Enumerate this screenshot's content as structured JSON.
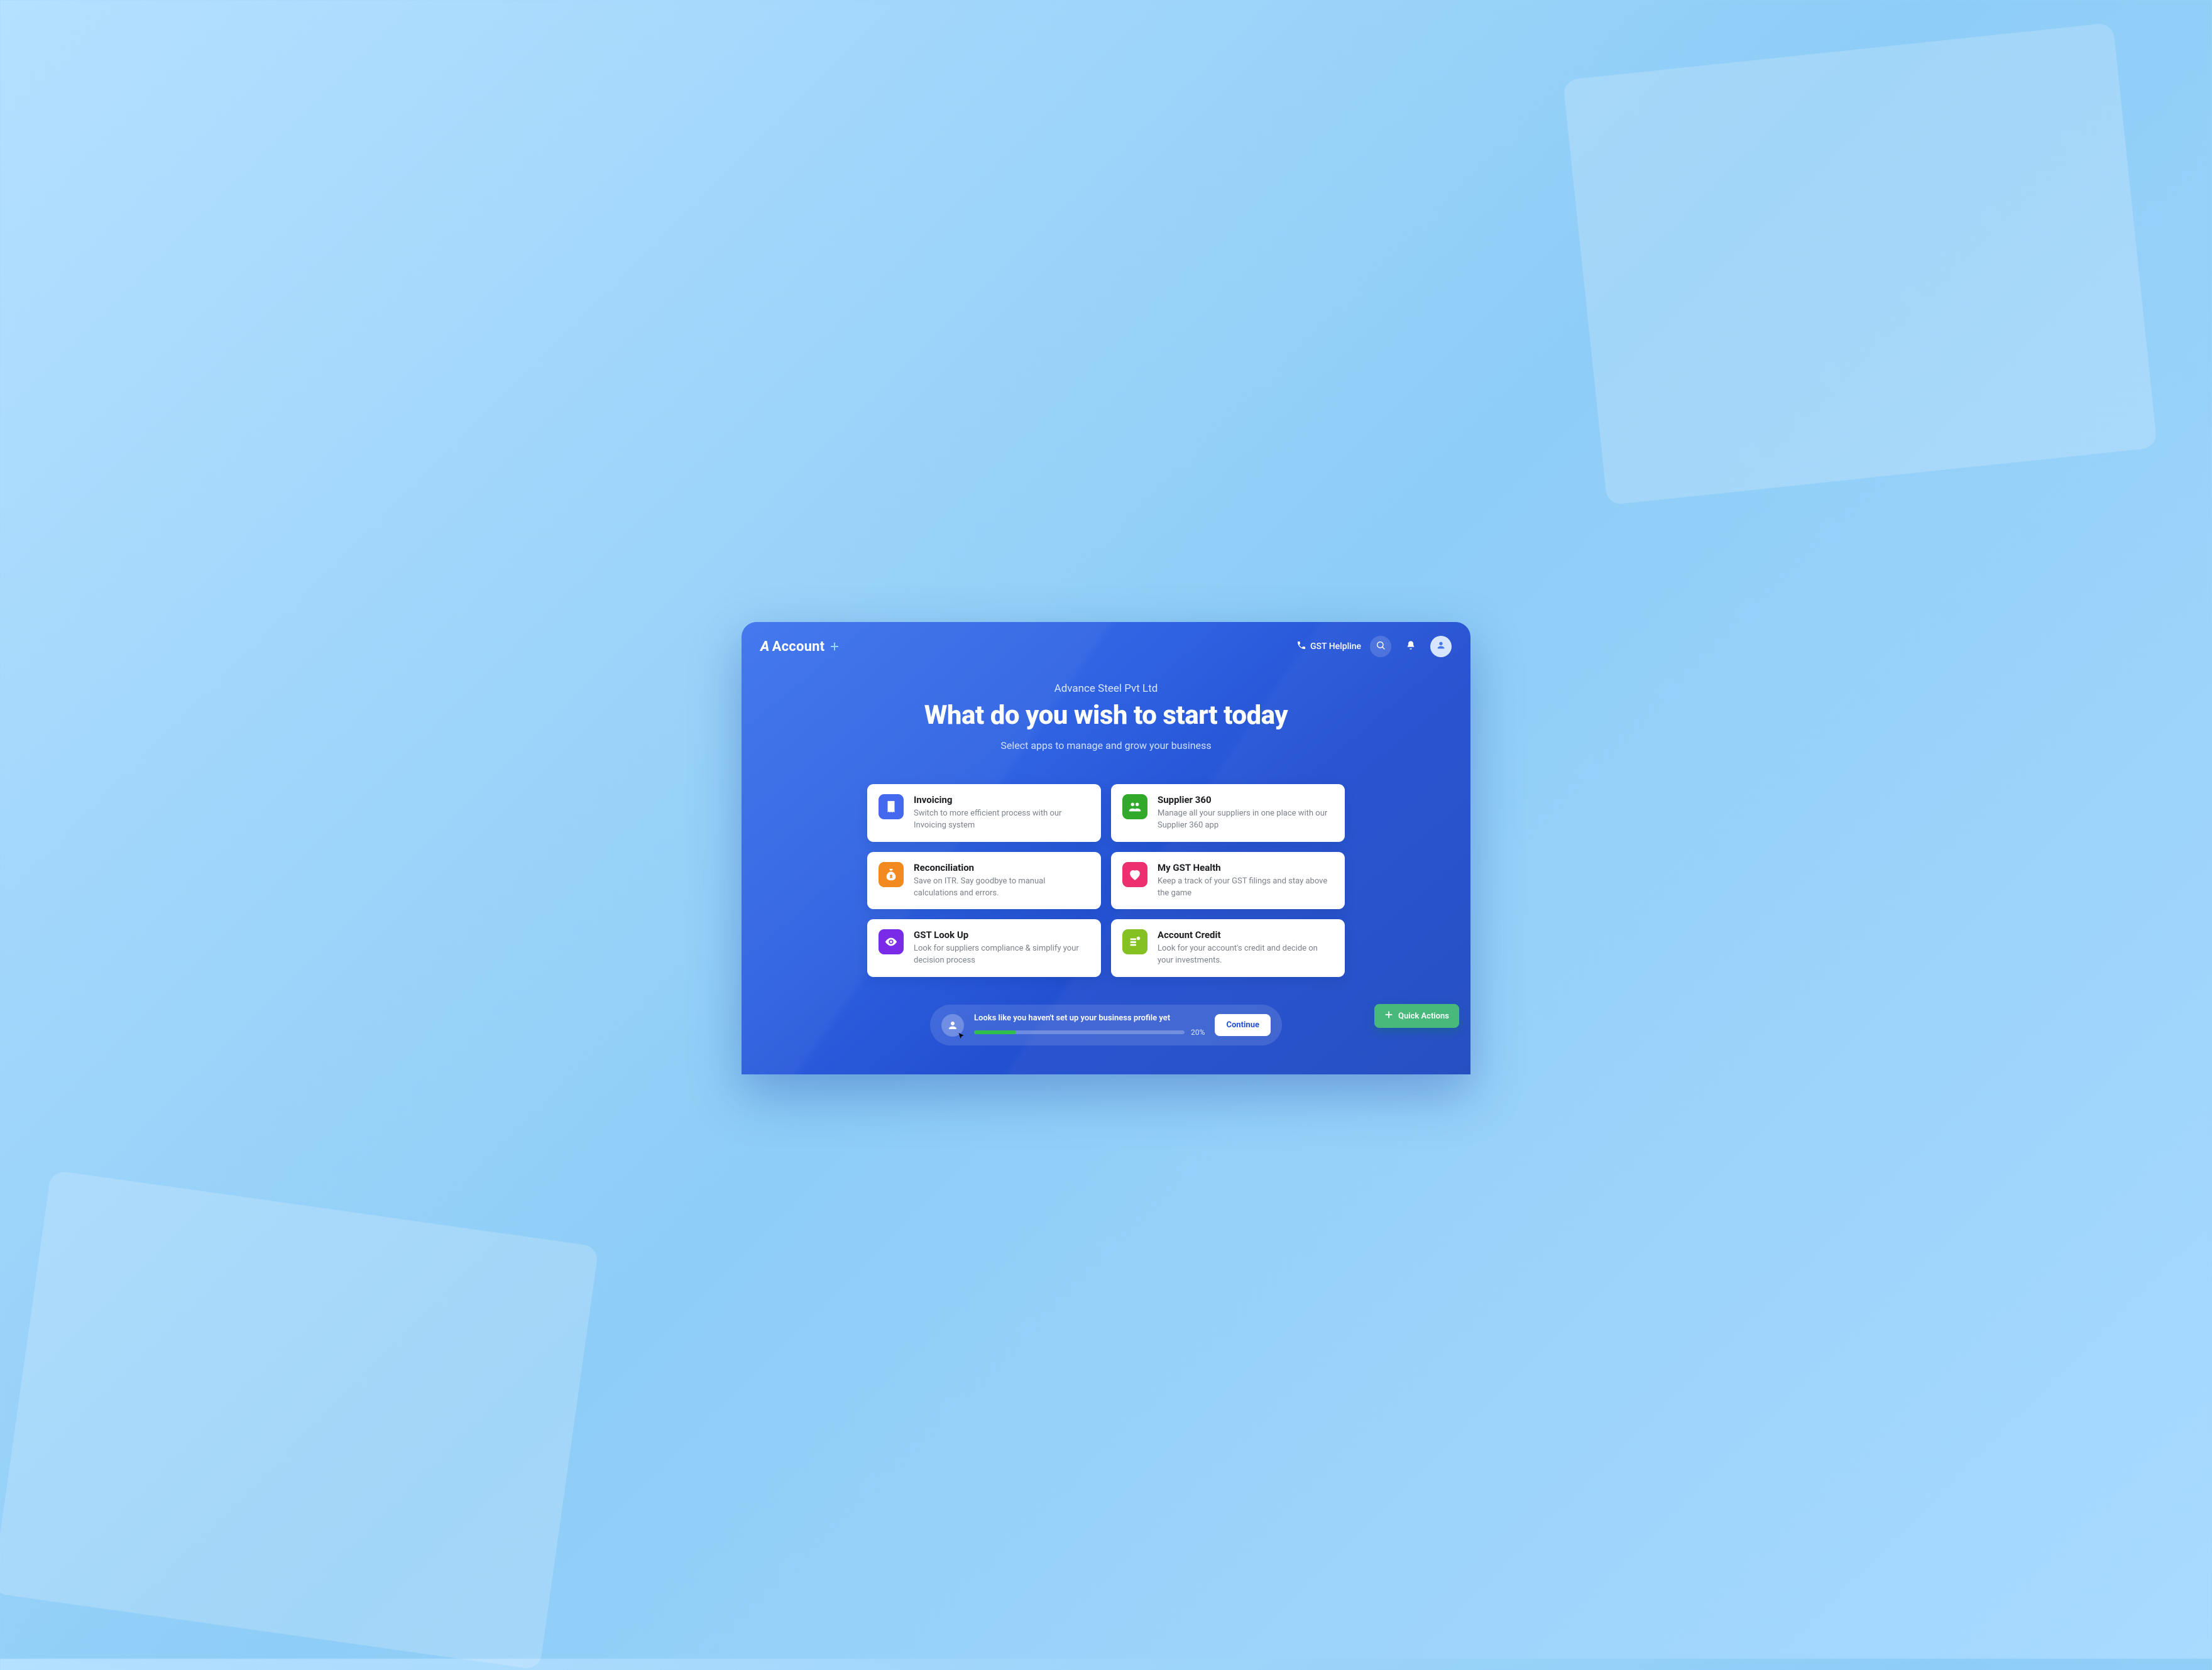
{
  "brand": {
    "name": "Account"
  },
  "header": {
    "helpline_label": "GST Helpline"
  },
  "hero": {
    "company": "Advance Steel Pvt Ltd",
    "title": "What do you wish to start today",
    "subtitle": "Select apps to manage and grow your business"
  },
  "apps": [
    {
      "key": "invoicing",
      "title": "Invoicing",
      "desc": "Switch to more efficient process with our Invoicing system",
      "color": "blue",
      "icon": "receipt"
    },
    {
      "key": "supplier360",
      "title": "Supplier 360",
      "desc": "Manage all your suppliers in one place with our Supplier 360 app",
      "color": "green",
      "icon": "people"
    },
    {
      "key": "reconciliation",
      "title": " Reconciliation",
      "desc": "Save on ITR. Say goodbye to manual calculations and errors.",
      "color": "orange",
      "icon": "bag"
    },
    {
      "key": "gsthealth",
      "title": "My GST Health",
      "desc": "Keep a track of your GST filings and stay above the game",
      "color": "pink",
      "icon": "heart"
    },
    {
      "key": "gstlookup",
      "title": "GST Look Up",
      "desc": "Look for suppliers compliance & simplify your decision process",
      "color": "purple",
      "icon": "eye"
    },
    {
      "key": "credit",
      "title": "Account Credit",
      "desc": "Look for your account's credit and decide on your investments.",
      "color": "lime",
      "icon": "coins"
    }
  ],
  "banner": {
    "text": "Looks like you haven't set up your business profile yet",
    "progress_pct": 20,
    "progress_label": "20%",
    "cta": "Continue"
  },
  "fab": {
    "label": "Quick Actions"
  },
  "colors": {
    "accent": "#2f62e2",
    "fab": "#48b97a",
    "progress": "#30c04a"
  }
}
